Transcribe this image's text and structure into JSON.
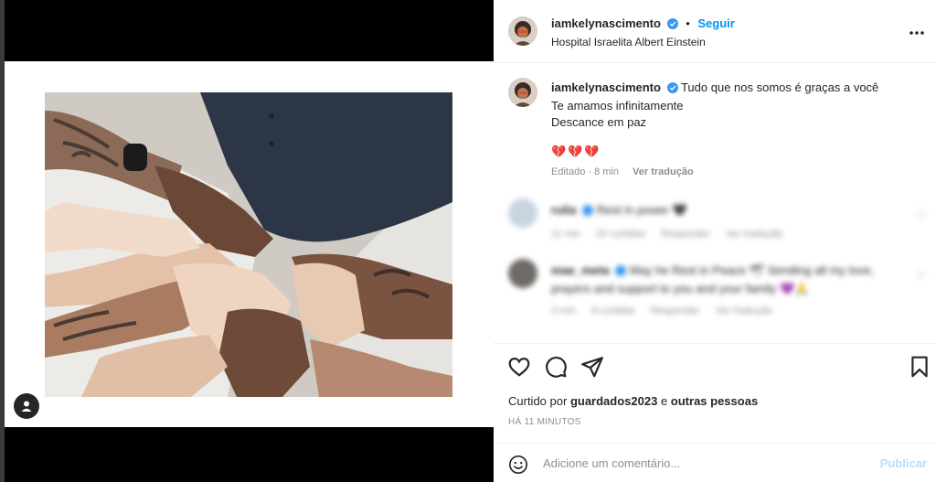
{
  "post": {
    "username": "iamkelynascimento",
    "follow_label": "Seguir",
    "separator": "•",
    "location": "Hospital Israelita Albert Einstein",
    "media_alt": "Mãos unidas sobre leito hospitalar"
  },
  "caption": {
    "username": "iamkelynascimento",
    "line1": "Tudo que nos somos é graças a você",
    "line2": "Te amamos infinitamente",
    "line3": "Descance em paz",
    "hearts": "💔💔💔",
    "edited": "Editado · 8 min",
    "translate": "Ver tradução"
  },
  "comments": [
    {
      "username": "rulia",
      "text": "Rest in power 🖤",
      "time": "11 min",
      "likes": "20 curtidas",
      "reply": "Responder",
      "translate": "Ver tradução"
    },
    {
      "username": "mae_meta",
      "text": "May he Rest in Peace 🕊 Sending all my love, prayers and support to you and your family 💜🙏",
      "time": "3 min",
      "likes": "8 curtidas",
      "reply": "Responder",
      "translate": "Ver tradução"
    }
  ],
  "actions": {
    "liked_by_prefix": "Curtido por",
    "liked_by_user": "guardados2023",
    "liked_by_conj": "e",
    "liked_by_others": "outras pessoas",
    "timestamp": "HÁ 11 MINUTOS"
  },
  "composer": {
    "placeholder": "Adicione um comentário...",
    "publish_label": "Publicar"
  },
  "colors": {
    "accent": "#0095f6",
    "verified": "#3897f0",
    "publish_disabled": "#b2dffc",
    "heart": "#d8234f"
  },
  "icons": [
    "user-tag-icon",
    "verified-badge-icon",
    "more-options-icon",
    "heart-icon",
    "comment-icon",
    "share-icon",
    "bookmark-icon",
    "emoji-icon",
    "broken-heart-icon"
  ]
}
